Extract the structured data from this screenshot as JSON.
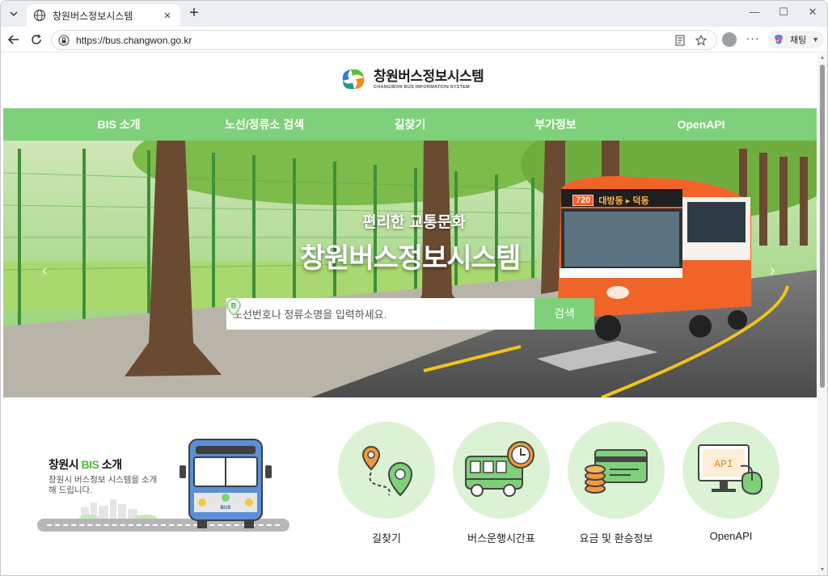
{
  "browser": {
    "tab_title": "창원버스정보시스템",
    "url": "https://bus.changwon.go.kr",
    "copilot_label": "채팅"
  },
  "site": {
    "logo_title": "창원버스정보시스템",
    "logo_subtitle": "CHANGWON BUS INFORMATION SYSTEM"
  },
  "nav": {
    "items": [
      {
        "label": "BIS 소개"
      },
      {
        "label": "노선/정류소 검색"
      },
      {
        "label": "길찾기"
      },
      {
        "label": "부가정보"
      },
      {
        "label": "OpenAPI"
      }
    ]
  },
  "hero": {
    "subtitle": "편리한 교통문화",
    "title": "창원버스정보시스템",
    "bus_number": "720",
    "bus_route": "대방동 ▸ 덕동",
    "search_placeholder": "노선번호나 정류소명을 입력하세요.",
    "search_button": "검색",
    "pin_letter": "B"
  },
  "intro": {
    "title_prefix": "창원시 ",
    "title_highlight": "BIS",
    "title_suffix": " 소개",
    "description": "창원시 버스정보 시스템을 소개해 드립니다.",
    "bus_label": "BUS"
  },
  "quick_links": [
    {
      "label": "길찾기",
      "icon": "route-map-icon"
    },
    {
      "label": "버스운행시간표",
      "icon": "bus-timetable-icon"
    },
    {
      "label": "요금 및 환승정보",
      "icon": "fare-card-coins-icon"
    },
    {
      "label": "OpenAPI",
      "icon": "api-monitor-icon",
      "screen_text": "API"
    }
  ],
  "colors": {
    "accent_green": "#7fd07a",
    "light_green": "#dcf2d4",
    "bus_orange": "#f0642a"
  }
}
